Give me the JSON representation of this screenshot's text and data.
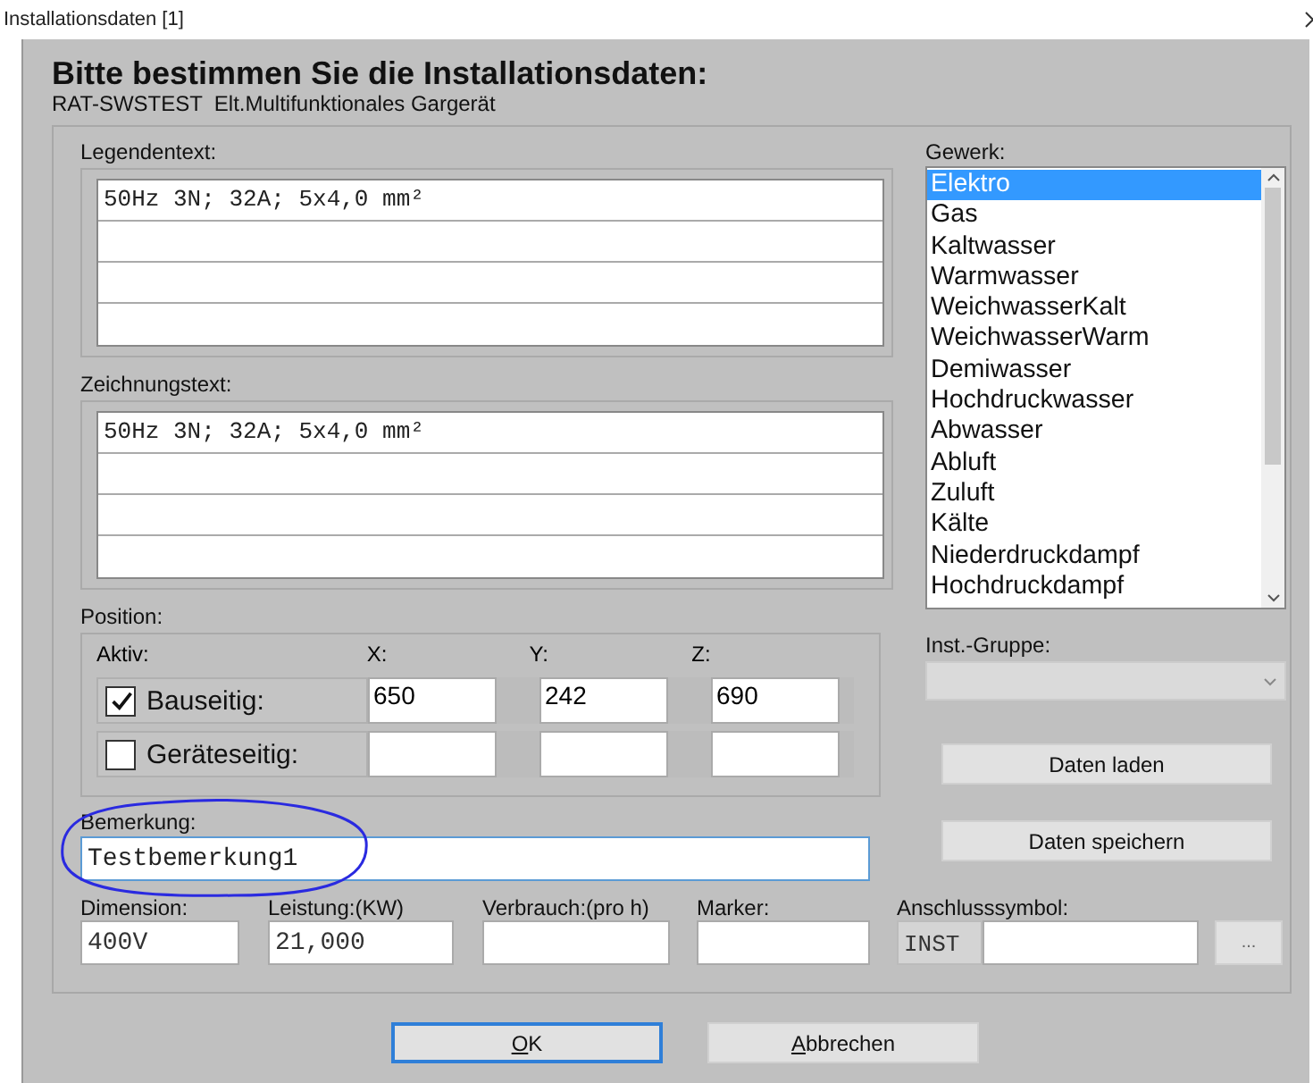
{
  "window": {
    "title": "Installationsdaten [1]"
  },
  "heading": "Bitte bestimmen Sie die Installationsdaten:",
  "subtitle": "RAT-SWSTEST  Elt.Multifunktionales Gargerät",
  "legend": {
    "label": "Legendentext:",
    "lines": [
      "50Hz 3N; 32A; 5x4,0 mm²"
    ]
  },
  "drawing_text": {
    "label": "Zeichnungstext:",
    "lines": [
      "50Hz 3N; 32A; 5x4,0 mm²"
    ]
  },
  "position": {
    "label": "Position:",
    "active_label": "Aktiv:",
    "axes": [
      "X:",
      "Y:",
      "Z:"
    ],
    "rows": [
      {
        "label": "Bauseitig:",
        "checked": true,
        "values": [
          "650",
          "242",
          "690"
        ]
      },
      {
        "label": "Geräteseitig:",
        "checked": false,
        "values": []
      }
    ]
  },
  "remark": {
    "label": "Bemerkung:",
    "value": "Testbemerkung1"
  },
  "fields": [
    {
      "label": "Dimension:",
      "value": "400V"
    },
    {
      "label": "Leistung:(KW)",
      "value": "21,000"
    },
    {
      "label": "Verbrauch:(pro h)"
    },
    {
      "label": "Marker:"
    }
  ],
  "gewerk": {
    "label": "Gewerk:",
    "items": [
      {
        "label": "Elektro",
        "selected": true
      },
      {
        "label": "Gas",
        "selected": false
      },
      {
        "label": "Kaltwasser",
        "selected": false
      },
      {
        "label": "Warmwasser",
        "selected": false
      },
      {
        "label": "WeichwasserKalt",
        "selected": false
      },
      {
        "label": "WeichwasserWarm",
        "selected": false
      },
      {
        "label": "Demiwasser",
        "selected": false
      },
      {
        "label": "Hochdruckwasser",
        "selected": false
      },
      {
        "label": "Abwasser",
        "selected": false
      },
      {
        "label": "Abluft",
        "selected": false
      },
      {
        "label": "Zuluft",
        "selected": false
      },
      {
        "label": "Kälte",
        "selected": false
      },
      {
        "label": "Niederdruckdampf",
        "selected": false
      },
      {
        "label": "Hochdruckdampf",
        "selected": false
      }
    ]
  },
  "inst_group": {
    "label": "Inst.-Gruppe:"
  },
  "side_buttons": [
    "Daten laden",
    "Daten speichern"
  ],
  "connection_symbol": {
    "label": "Anschlusssymbol:",
    "prefix": "INST",
    "browse": "..."
  },
  "buttons": [
    {
      "label": "OK",
      "default": true
    },
    {
      "label": "Abbrechen",
      "default": false
    }
  ]
}
